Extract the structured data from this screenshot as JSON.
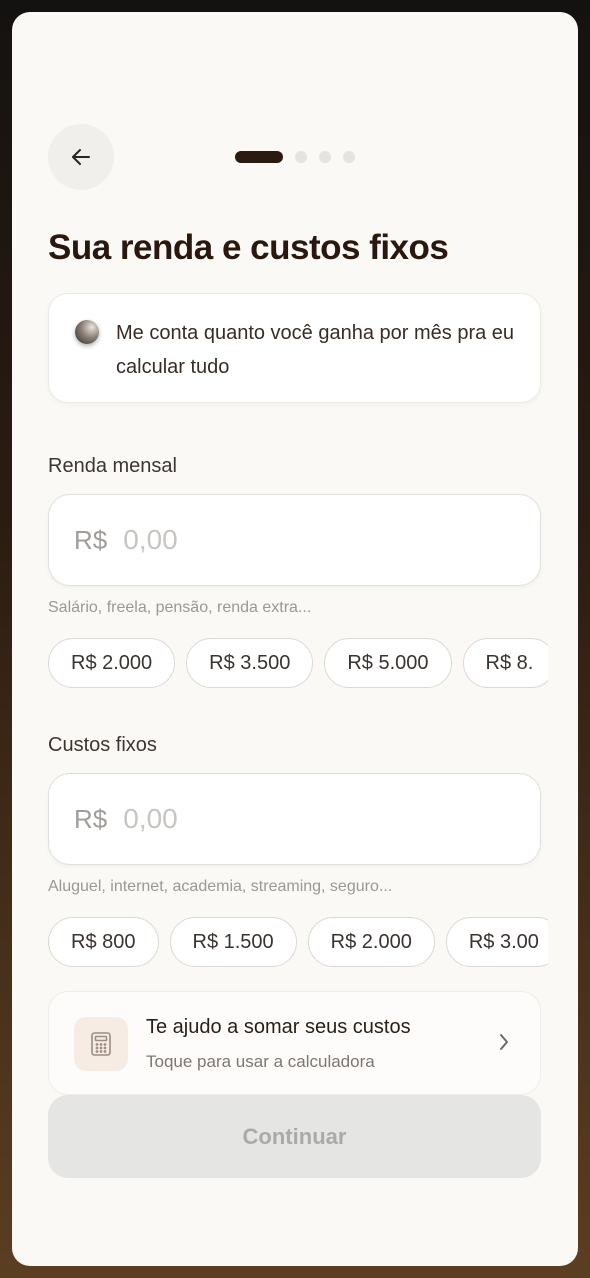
{
  "header": {
    "back_icon": "arrow-left-icon",
    "progress": {
      "current_step": 1,
      "total_steps": 4
    }
  },
  "title": "Sua renda e custos fixos",
  "assistant": {
    "message": "Me conta quanto você ganha por mês pra eu calcular tudo"
  },
  "income": {
    "label": "Renda mensal",
    "currency": "R$",
    "placeholder": "0,00",
    "hint": "Salário, freela, pensão, renda extra...",
    "chips": [
      "R$ 2.000",
      "R$ 3.500",
      "R$ 5.000",
      "R$ 8."
    ]
  },
  "fixed_costs": {
    "label": "Custos fixos",
    "currency": "R$",
    "placeholder": "0,00",
    "hint": "Aluguel, internet, academia, streaming, seguro...",
    "chips": [
      "R$ 800",
      "R$ 1.500",
      "R$ 2.000",
      "R$ 3.00"
    ]
  },
  "calculator": {
    "title": "Te ajudo a somar seus custos",
    "subtitle": "Toque para usar a calculadora",
    "icon": "calculator-icon",
    "chevron": "chevron-right-icon"
  },
  "continue_label": "Continuar",
  "colors": {
    "primary_dark": "#2b1a10",
    "accent_light": "#f6ece4",
    "disabled_bg": "#e5e5e4"
  }
}
